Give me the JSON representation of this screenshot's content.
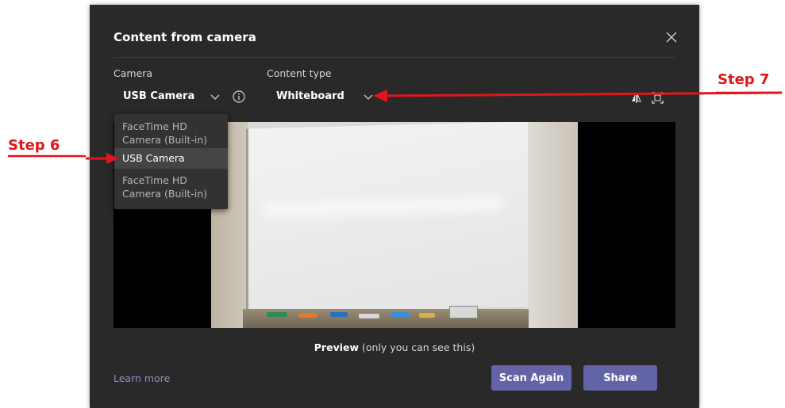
{
  "dialog": {
    "title": "Content from camera",
    "close_icon": "close-icon"
  },
  "camera": {
    "label": "Camera",
    "value": "USB Camera",
    "options": [
      "FaceTime HD Camera (Built-in)",
      "USB Camera",
      "FaceTime HD Camera (Built-in)"
    ],
    "options_lines": [
      [
        "FaceTime HD",
        "Camera (Built-in)"
      ],
      [
        "USB Camera"
      ],
      [
        "FaceTime HD",
        "Camera (Built-in)"
      ]
    ],
    "selected_index": 1
  },
  "content_type": {
    "label": "Content type",
    "value": "Whiteboard"
  },
  "preview": {
    "caption_bold": "Preview",
    "caption_rest": " (only you can see this)"
  },
  "footer": {
    "learn_more": "Learn more",
    "scan_again": "Scan Again",
    "share": "Share"
  },
  "annotations": {
    "step6": "Step 6",
    "step7": "Step 7",
    "color": "#e0161b"
  },
  "colors": {
    "dialog_bg": "#292929",
    "accent": "#6264a7",
    "link": "#8b8cc7"
  }
}
